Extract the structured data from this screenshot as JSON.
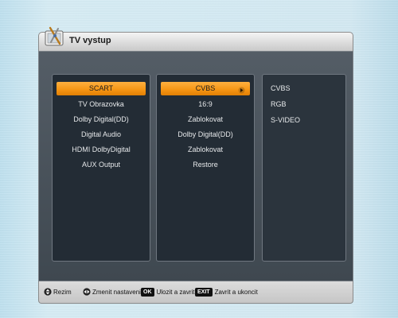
{
  "dialog": {
    "title": "TV vystup",
    "icon": "tv-settings-icon"
  },
  "menu": {
    "items": [
      {
        "label": "SCART",
        "selected": true
      },
      {
        "label": "TV Obrazovka"
      },
      {
        "label": "Dolby Digital(DD)"
      },
      {
        "label": "Digital Audio"
      },
      {
        "label": "HDMI DolbyDigital"
      },
      {
        "label": "AUX Output"
      }
    ]
  },
  "values": {
    "items": [
      {
        "label": "CVBS",
        "selected": true
      },
      {
        "label": "16:9"
      },
      {
        "label": "Zablokovat"
      },
      {
        "label": "Dolby Digital(DD)"
      },
      {
        "label": "Zablokovat"
      },
      {
        "label": "Restore"
      }
    ]
  },
  "options": {
    "items": [
      "CVBS",
      "RGB",
      "S-VIDEO"
    ]
  },
  "footer": {
    "mode_label": "Rezim",
    "change_label": "Zmenit nastaveni",
    "ok_key": "OK",
    "ok_label": "Ulozit a zavrit",
    "exit_key": "EXIT",
    "exit_label": "Zavrit a ukoncit"
  },
  "colors": {
    "highlight": "#f59412",
    "panel": "#232c35",
    "frame": "#545d66"
  }
}
